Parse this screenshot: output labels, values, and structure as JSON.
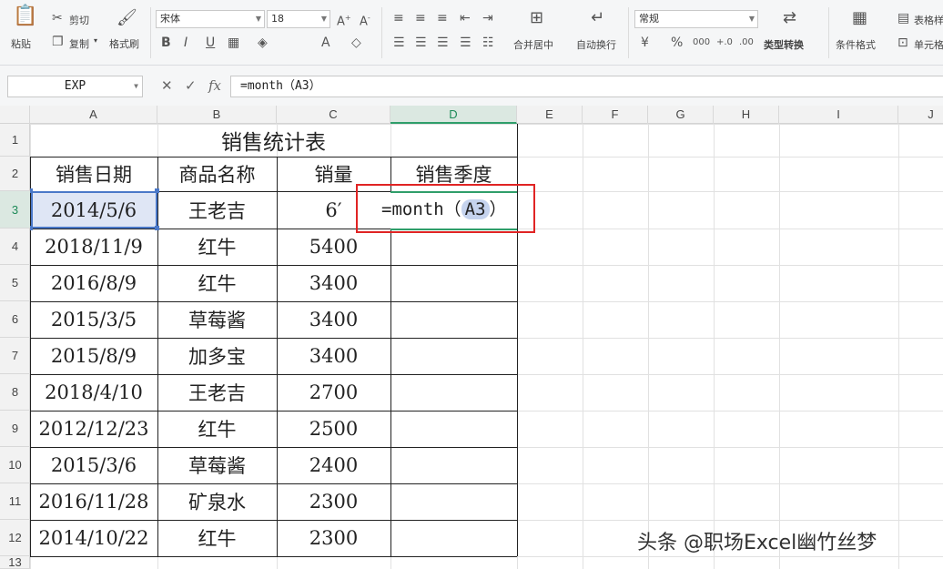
{
  "ribbon": {
    "paste": "粘贴",
    "cut": "剪切",
    "copy": "复制",
    "format_painter": "格式刷",
    "font_name": "宋体",
    "font_size": "18",
    "merge_center": "合并居中",
    "wrap_text": "自动换行",
    "number_format": "常规",
    "type_convert": "类型转换",
    "conditional_format": "条件格式",
    "table_style": "表格样",
    "cell_label": "单元格"
  },
  "formula_bar": {
    "name_box": "EXP",
    "formula": "=month（A3）"
  },
  "grid": {
    "columns": [
      "A",
      "B",
      "C",
      "D",
      "E",
      "F",
      "G",
      "H",
      "I",
      "J"
    ],
    "rows": [
      "1",
      "2",
      "3",
      "4",
      "5",
      "6",
      "7",
      "8",
      "9",
      "10",
      "11",
      "12",
      "13"
    ],
    "title": "销售统计表",
    "headers": [
      "销售日期",
      "商品名称",
      "销量",
      "销售季度"
    ],
    "data": [
      [
        "2014/5/6",
        "王老吉",
        "6′"
      ],
      [
        "2018/11/9",
        "红牛",
        "5400"
      ],
      [
        "2016/8/9",
        "红牛",
        "3400"
      ],
      [
        "2015/3/5",
        "草莓酱",
        "3400"
      ],
      [
        "2015/8/9",
        "加多宝",
        "3400"
      ],
      [
        "2018/4/10",
        "王老吉",
        "2700"
      ],
      [
        "2012/12/23",
        "红牛",
        "2500"
      ],
      [
        "2015/3/6",
        "草莓酱",
        "2400"
      ],
      [
        "2016/11/28",
        "矿泉水",
        "2300"
      ],
      [
        "2014/10/22",
        "红牛",
        "2300"
      ]
    ],
    "editing_cell": {
      "prefix": "=month（",
      "ref": "A3",
      "suffix": "）"
    }
  },
  "watermark": "头条 @职场Excel幽竹丝梦",
  "colors": {
    "accent_green": "#2f9e6a",
    "highlight_red": "#e02424",
    "ref_blue": "#4a78c8"
  }
}
